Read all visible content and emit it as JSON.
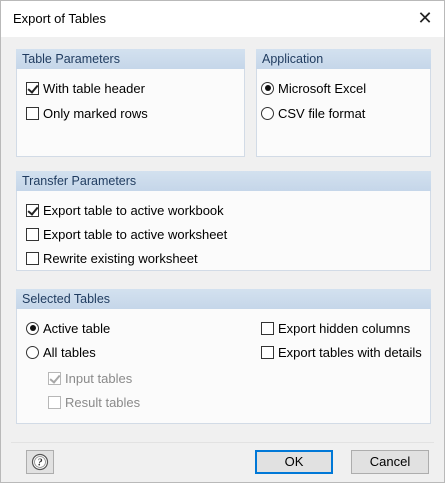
{
  "window": {
    "title": "Export of Tables",
    "close_glyph": "✕"
  },
  "table_parameters": {
    "header": "Table Parameters",
    "with_table_header": {
      "label": "With table header",
      "checked": true
    },
    "only_marked_rows": {
      "label": "Only marked rows",
      "checked": false
    }
  },
  "application": {
    "header": "Application",
    "microsoft_excel": {
      "label": "Microsoft Excel",
      "selected": true
    },
    "csv_file_format": {
      "label": "CSV file format",
      "selected": false
    }
  },
  "transfer_parameters": {
    "header": "Transfer Parameters",
    "export_to_active_workbook": {
      "label": "Export table to active workbook",
      "checked": true
    },
    "export_to_active_worksheet": {
      "label": "Export table to active worksheet",
      "checked": false
    },
    "rewrite_existing_worksheet": {
      "label": "Rewrite existing worksheet",
      "checked": false
    }
  },
  "selected_tables": {
    "header": "Selected Tables",
    "active_table": {
      "label": "Active table",
      "selected": true
    },
    "all_tables": {
      "label": "All tables",
      "selected": false
    },
    "input_tables": {
      "label": "Input tables",
      "checked": true,
      "disabled": true
    },
    "result_tables": {
      "label": "Result tables",
      "checked": false,
      "disabled": true
    },
    "export_hidden_columns": {
      "label": "Export hidden columns",
      "checked": false
    },
    "export_tables_with_details": {
      "label": "Export tables with details",
      "checked": false
    }
  },
  "buttons": {
    "ok": "OK",
    "cancel": "Cancel",
    "help_icon": "help-icon"
  }
}
